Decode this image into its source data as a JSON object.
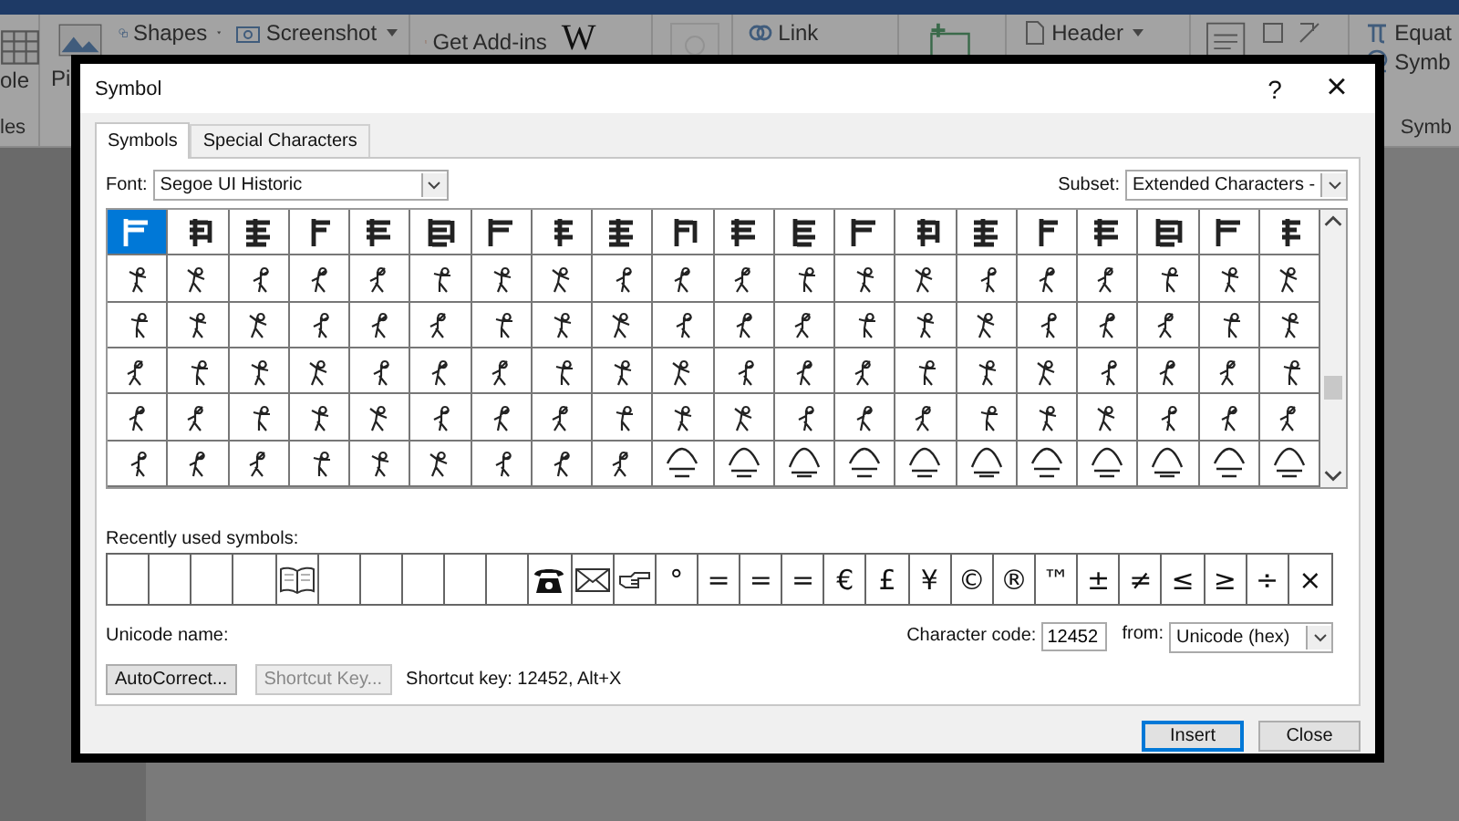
{
  "ribbon": {
    "left_group": {
      "button_label": "ole",
      "group_label": "les"
    },
    "items": [
      {
        "label": "Pi",
        "kind": "picture"
      },
      {
        "label": "Shapes",
        "kind": "shapes"
      },
      {
        "label": "Screenshot",
        "kind": "screenshot"
      },
      {
        "label": "Get Add-ins",
        "kind": "addins"
      },
      {
        "label": "W",
        "kind": "letter"
      },
      {
        "label": "Link",
        "kind": "link"
      },
      {
        "label": "Header",
        "kind": "header"
      },
      {
        "label": "Equat",
        "kind": "equation"
      },
      {
        "label": "Symb",
        "kind": "symbol"
      }
    ],
    "right_group_label": "Symb"
  },
  "dialog": {
    "title": "Symbol",
    "help": "?",
    "close": "×",
    "tabs": [
      {
        "label": "Symbols",
        "selected": true
      },
      {
        "label": "Special Characters",
        "selected": false
      }
    ],
    "font": {
      "label": "Font:",
      "value": "Segoe UI Historic"
    },
    "subset": {
      "label": "Subset:",
      "value": "Extended Characters -"
    },
    "grid": [
      [
        {
          "selected": true
        },
        {
          "selected": false
        },
        {
          "selected": false
        },
        {
          "selected": false
        },
        {
          "selected": false
        },
        {
          "selected": false
        },
        {
          "selected": false
        },
        {
          "selected": false
        },
        {
          "selected": false
        },
        {
          "selected": false
        },
        {
          "selected": false
        },
        {
          "selected": false
        },
        {
          "selected": false
        },
        {
          "selected": false
        },
        {
          "selected": false
        },
        {
          "selected": false
        },
        {
          "selected": false
        },
        {
          "selected": false
        },
        {
          "selected": false
        },
        {
          "selected": false
        }
      ],
      [
        {
          "selected": false
        },
        {
          "selected": false
        },
        {
          "selected": false
        },
        {
          "selected": false
        },
        {
          "selected": false
        },
        {
          "selected": false
        },
        {
          "selected": false
        },
        {
          "selected": false
        },
        {
          "selected": false
        },
        {
          "selected": false
        },
        {
          "selected": false
        },
        {
          "selected": false
        },
        {
          "selected": false
        },
        {
          "selected": false
        },
        {
          "selected": false
        },
        {
          "selected": false
        },
        {
          "selected": false
        },
        {
          "selected": false
        },
        {
          "selected": false
        },
        {
          "selected": false
        }
      ],
      [
        {
          "selected": false
        },
        {
          "selected": false
        },
        {
          "selected": false
        },
        {
          "selected": false
        },
        {
          "selected": false
        },
        {
          "selected": false
        },
        {
          "selected": false
        },
        {
          "selected": false
        },
        {
          "selected": false
        },
        {
          "selected": false
        },
        {
          "selected": false
        },
        {
          "selected": false
        },
        {
          "selected": false
        },
        {
          "selected": false
        },
        {
          "selected": false
        },
        {
          "selected": false
        },
        {
          "selected": false
        },
        {
          "selected": false
        },
        {
          "selected": false
        },
        {
          "selected": false
        }
      ],
      [
        {
          "selected": false
        },
        {
          "selected": false
        },
        {
          "selected": false
        },
        {
          "selected": false
        },
        {
          "selected": false
        },
        {
          "selected": false
        },
        {
          "selected": false
        },
        {
          "selected": false
        },
        {
          "selected": false
        },
        {
          "selected": false
        },
        {
          "selected": false
        },
        {
          "selected": false
        },
        {
          "selected": false
        },
        {
          "selected": false
        },
        {
          "selected": false
        },
        {
          "selected": false
        },
        {
          "selected": false
        },
        {
          "selected": false
        },
        {
          "selected": false
        },
        {
          "selected": false
        }
      ],
      [
        {
          "selected": false
        },
        {
          "selected": false
        },
        {
          "selected": false
        },
        {
          "selected": false
        },
        {
          "selected": false
        },
        {
          "selected": false
        },
        {
          "selected": false
        },
        {
          "selected": false
        },
        {
          "selected": false
        },
        {
          "selected": false
        },
        {
          "selected": false
        },
        {
          "selected": false
        },
        {
          "selected": false
        },
        {
          "selected": false
        },
        {
          "selected": false
        },
        {
          "selected": false
        },
        {
          "selected": false
        },
        {
          "selected": false
        },
        {
          "selected": false
        },
        {
          "selected": false
        }
      ],
      [
        {
          "selected": false
        },
        {
          "selected": false
        },
        {
          "selected": false
        },
        {
          "selected": false
        },
        {
          "selected": false
        },
        {
          "selected": false
        },
        {
          "selected": false
        },
        {
          "selected": false
        },
        {
          "selected": false
        },
        {
          "selected": false
        },
        {
          "selected": false
        },
        {
          "selected": false
        },
        {
          "selected": false
        },
        {
          "selected": false
        },
        {
          "selected": false
        },
        {
          "selected": false
        },
        {
          "selected": false
        },
        {
          "selected": false
        },
        {
          "selected": false
        },
        {
          "selected": false
        }
      ]
    ],
    "recent_label": "Recently used symbols:",
    "recent": [
      {
        "kind": "empty"
      },
      {
        "kind": "empty"
      },
      {
        "kind": "empty"
      },
      {
        "kind": "empty"
      },
      {
        "kind": "book"
      },
      {
        "kind": "empty"
      },
      {
        "kind": "empty"
      },
      {
        "kind": "empty"
      },
      {
        "kind": "empty"
      },
      {
        "kind": "empty"
      },
      {
        "kind": "telephone"
      },
      {
        "kind": "envelope"
      },
      {
        "kind": "hand"
      },
      {
        "kind": "char",
        "symbol": "°"
      },
      {
        "kind": "char",
        "symbol": "="
      },
      {
        "kind": "char",
        "symbol": "="
      },
      {
        "kind": "char",
        "symbol": "="
      },
      {
        "kind": "char",
        "symbol": "€"
      },
      {
        "kind": "char",
        "symbol": "£"
      },
      {
        "kind": "char",
        "symbol": "¥"
      },
      {
        "kind": "char",
        "symbol": "©"
      },
      {
        "kind": "char",
        "symbol": "®"
      },
      {
        "kind": "char",
        "symbol": "™"
      },
      {
        "kind": "char",
        "symbol": "±"
      },
      {
        "kind": "char",
        "symbol": "≠"
      },
      {
        "kind": "char",
        "symbol": "≤"
      },
      {
        "kind": "char",
        "symbol": "≥"
      },
      {
        "kind": "char",
        "symbol": "÷"
      },
      {
        "kind": "char",
        "symbol": "×"
      }
    ],
    "unicode_name_label": "Unicode name:",
    "character_code": {
      "label": "Character code:",
      "value": "12452"
    },
    "from": {
      "label": "from:",
      "value": "Unicode (hex)"
    },
    "buttons": [
      {
        "label": "AutoCorrect...",
        "disabled": false
      },
      {
        "label": "Shortcut Key...",
        "disabled": true
      }
    ],
    "shortcut_text": "Shortcut key: 12452, Alt+X",
    "footer_buttons": [
      {
        "label": "Insert",
        "default": true
      },
      {
        "label": "Close",
        "default": false
      }
    ]
  }
}
